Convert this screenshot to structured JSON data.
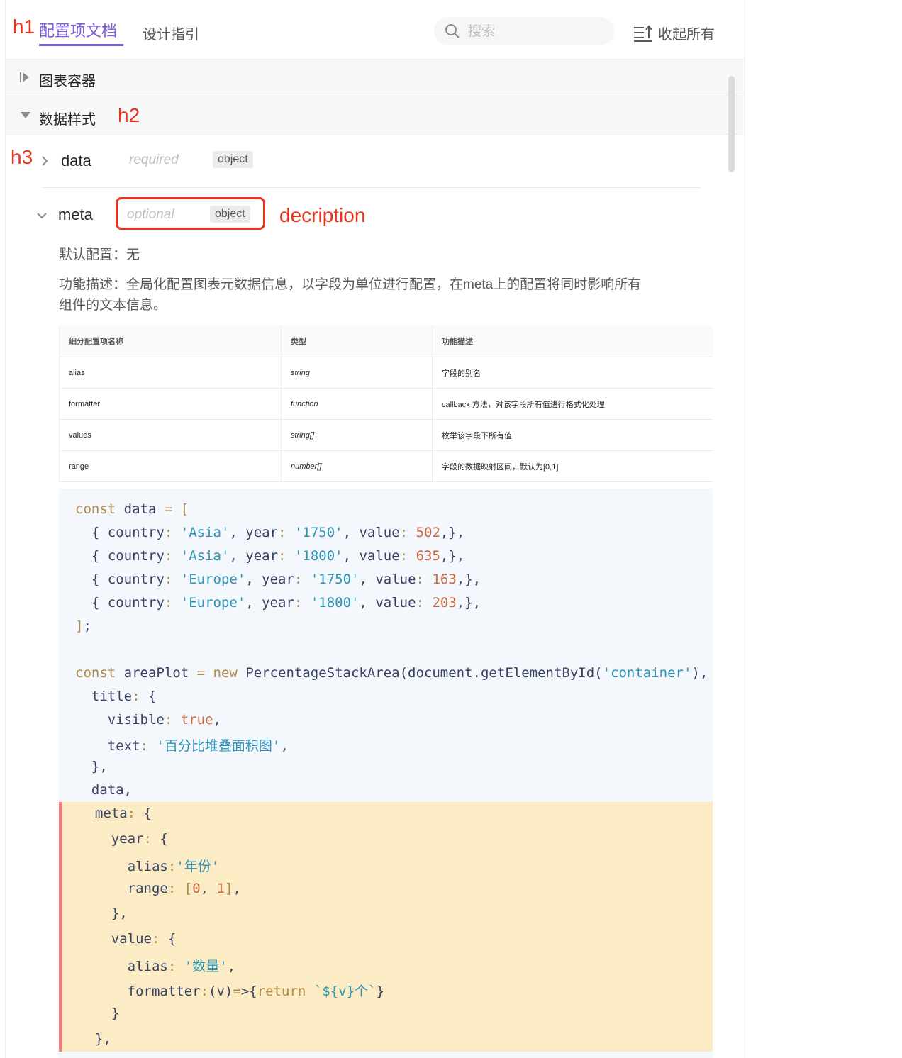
{
  "annotations": {
    "h1": "h1",
    "h2": "h2",
    "h3": "h3",
    "description": "decription"
  },
  "header": {
    "tab_active": "配置项文档",
    "tab_other": "设计指引",
    "search_placeholder": "搜索",
    "collapse_label": "收起所有"
  },
  "sections": [
    {
      "label": "图表容器",
      "state": "collapsed"
    },
    {
      "label": "数据样式",
      "state": "expanded"
    }
  ],
  "props": {
    "data": {
      "name": "data",
      "flag": "required",
      "type": "object"
    },
    "meta": {
      "name": "meta",
      "flag": "optional",
      "type": "object"
    }
  },
  "meta_desc": {
    "default": "默认配置：无",
    "func_line1": "功能描述：全局化配置图表元数据信息，以字段为单位进行配置，在meta上的配置将同时影响所有",
    "func_line2": "组件的文本信息。"
  },
  "table": {
    "headers": [
      "细分配置项名称",
      "类型",
      "功能描述"
    ],
    "rows": [
      [
        "alias",
        "string",
        "字段的别名"
      ],
      [
        "formatter",
        "function",
        "callback 方法，对该字段所有值进行格式化处理"
      ],
      [
        "values",
        "string[]",
        "枚举该字段下所有值"
      ],
      [
        "range",
        "number[]",
        "字段的数据映射区间，默认为[0,1]"
      ]
    ]
  },
  "code_lines": [
    "const data = [",
    "  { country: 'Asia', year: '1750', value: 502,},",
    "  { country: 'Asia', year: '1800', value: 635,},",
    "  { country: 'Europe', year: '1750', value: 163,},",
    "  { country: 'Europe', year: '1800', value: 203,},",
    "];",
    "",
    "const areaPlot = new PercentageStackArea(document.getElementById('container'), {",
    "  title: {",
    "    visible: true,",
    "    text: '百分比堆叠面积图',",
    "  },",
    "  data,",
    "  meta: {",
    "    year: {",
    "      alias:'年份'",
    "      range: [0, 1],",
    "    },",
    "    value: {",
    "      alias: '数量',",
    "      formatter:(v)=>{return `${v}个`}",
    "    }",
    "  },"
  ],
  "colors": {
    "accent": "#7c5cdb",
    "annotation": "#e8341c",
    "highlight": "#fbecc5",
    "highlight_border": "#f08080"
  }
}
